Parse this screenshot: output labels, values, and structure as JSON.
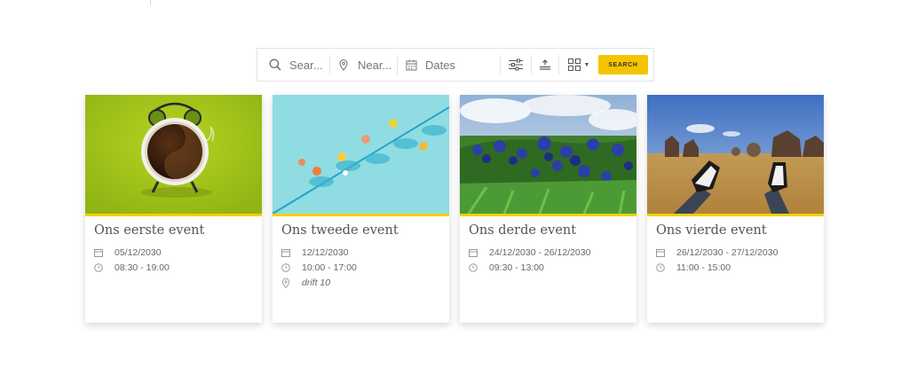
{
  "search": {
    "keyword_placeholder": "Sear...",
    "near_placeholder": "Near...",
    "dates_placeholder": "Dates",
    "button_label": "SEARCH",
    "accent_color": "#f5c400"
  },
  "events": [
    {
      "title": "Ons eerste event",
      "date": "05/12/2030",
      "time": "08:30 - 19:00",
      "location": ""
    },
    {
      "title": "Ons tweede event",
      "date": "12/12/2030",
      "time": "10:00 - 17:00",
      "location": "drift 10"
    },
    {
      "title": "Ons derde event",
      "date": "24/12/2030 - 26/12/2030",
      "time": "09:30 - 13:00",
      "location": ""
    },
    {
      "title": "Ons vierde event",
      "date": "26/12/2030 - 27/12/2030",
      "time": "11:00 - 15:00",
      "location": ""
    }
  ],
  "icons": {
    "keyword": "search-icon",
    "near": "map-pin-icon",
    "dates": "calendar-icon",
    "filters": "sliders-icon",
    "sort": "sort-icon",
    "view": "grid-icon",
    "card_date": "calendar-icon",
    "card_time": "clock-icon",
    "card_location": "map-pin-icon"
  }
}
